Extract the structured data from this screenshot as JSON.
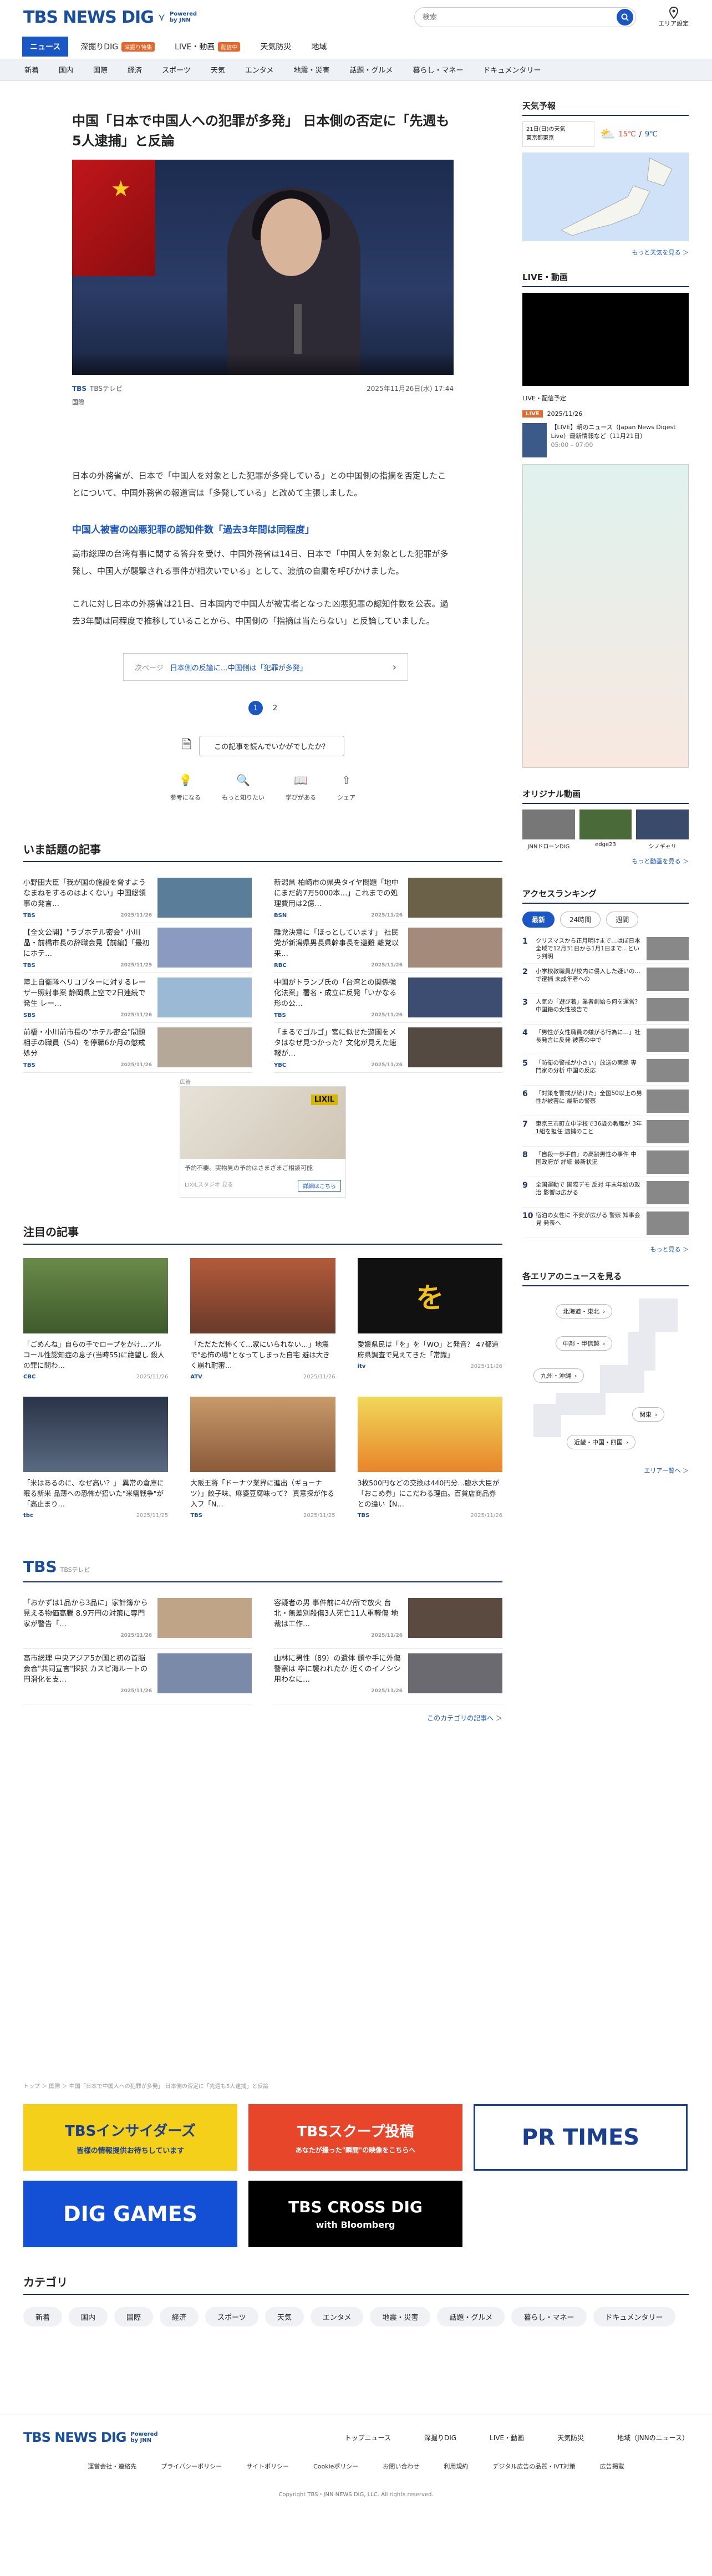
{
  "header": {
    "logo_tbs": "TBS NEWS DIG",
    "logo_powered": "Powered by JNN",
    "search_placeholder": "検索",
    "area_setting": "エリア設定"
  },
  "nav_primary": [
    {
      "label": "ニュース",
      "active": true
    },
    {
      "label": "深掘りDIG",
      "badge": "深掘り特集"
    },
    {
      "label": "LIVE・動画",
      "badge": "配信中"
    },
    {
      "label": "天気防災"
    },
    {
      "label": "地域"
    }
  ],
  "nav_secondary": [
    "新着",
    "国内",
    "国際",
    "経済",
    "スポーツ",
    "天気",
    "エンタメ",
    "地震・災害",
    "話題・グルメ",
    "暮らし・マネー",
    "ドキュメンタリー"
  ],
  "article": {
    "title": "中国「日本で中国人への犯罪が多発」 日本側の否定に「先週も5人逮捕」と反論",
    "source": "TBSテレビ",
    "date": "2025年11月26日(水) 17:44",
    "category_tag": "国際",
    "p1": "日本の外務省が、日本で「中国人を対象とした犯罪が多発している」との中国側の指摘を否定したことについて、中国外務省の報道官は「多発している」と改めて主張しました。",
    "subhead": "中国人被害の凶悪犯罪の認知件数「過去3年間は同程度」",
    "p2": "高市総理の台湾有事に関する答弁を受け、中国外務省は14日、日本で「中国人を対象とした犯罪が多発し、中国人が襲撃される事件が相次いでいる」として、渡航の自粛を呼びかけました。",
    "p3": "これに対し日本の外務省は21日、日本国内で中国人が被害者となった凶悪犯罪の認知件数を公表。過去3年間は同程度で推移していることから、中国側の「指摘は当たらない」と反論していました。",
    "related_label": "次ページ",
    "related_title": "日本側の反論に…中国側は「犯罪が多発」",
    "pages": [
      "1",
      "2"
    ],
    "feedback_q": "この記事を読んでいかがでしたか？",
    "reactions": [
      "参考になる",
      "もっと知りたい",
      "学びがある",
      "シェア"
    ]
  },
  "popular": {
    "heading": "いま話題の記事",
    "items": [
      {
        "title": "小野田大臣「我が国の施設を脅すようなまねをするのはよくない」中国総領事の発言…",
        "src": "TBS",
        "date": "2025/11/26"
      },
      {
        "title": "新潟県 柏崎市の県央タイヤ問題「地中にまだ約7万5000本…」これまでの処理費用は2億…",
        "src": "BSN",
        "date": "2025/11/26"
      },
      {
        "title": "【全文公開】\"ラブホテル密会\" 小川晶・前橋市長の辞職会見【前編】「最初にホテ…",
        "src": "TBS",
        "date": "2025/11/25"
      },
      {
        "title": "離党決意に「ほっとしています」 社民党が新潟県男長県幹事長を避難 離党以来…",
        "src": "RBC",
        "date": "2025/11/26"
      },
      {
        "title": "陸上自衛隊ヘリコプターに対するレーザー照射事案 静岡県上空で2日連続で発生 レー…",
        "src": "SBS",
        "date": "2025/11/26"
      },
      {
        "title": "中国がトランプ氏の「台湾との関係強化法案」署名・成立に反発「いかなる形の公…",
        "src": "TBS",
        "date": "2025/11/26"
      },
      {
        "title": "前橋・小川前市長の\"ホテル密会\"問題 相手の職員（54）を停職6か月の懲戒処分",
        "src": "TBS",
        "date": "2025/11/26"
      },
      {
        "title": "「まるでゴルゴ」宮に似せた遊園をメタはなぜ見つかった？文化が見えた速報が…",
        "src": "YBC",
        "date": "2025/11/26"
      }
    ]
  },
  "ad": {
    "label": "広告",
    "brand": "LIXIL",
    "text": "予約不要。実物見の予約はさまざまご相談可能",
    "footer": "LIXILスタジオ 見る",
    "button": "詳細はこちら"
  },
  "featured": {
    "heading": "注目の記事",
    "items": [
      {
        "title": "「ごめんね」自らの手でロープをかけ…アルコール性認知症の息子(当時55)に絶望し 殺人の罪に問わ…",
        "src": "CBC",
        "date": "2025/11/26"
      },
      {
        "title": "「ただただ怖くて…家にいられない…」地震で\"恐怖の場\"となってしまった自宅 避は大きく崩れ耐審…",
        "src": "ATV",
        "date": "2025/11/26"
      },
      {
        "title": "愛媛県民は「を」を「WO」と発音？ 47都道府県調査で見えてきた「常識」",
        "src": "itv",
        "date": "2025/11/26"
      },
      {
        "title": "「米はあるのに、なぜ高い？」 異常の倉庫に眠る新米 品薄への恐怖が招いた\"米需戦争\"が「高止まり…",
        "src": "tbc",
        "date": "2025/11/25"
      },
      {
        "title": "大阪王将「ドーナツ業界に進出（ギョーナツ）」餃子味、麻婆豆腐味って？ 真意探が作る入フ「N…",
        "src": "TBS",
        "date": "2025/11/25"
      },
      {
        "title": "3枚500円などの交換は440円分…臨水大臣が「おこめ券」にこだわる理由。百貨店商品券との違い【N…",
        "src": "TBS",
        "date": "2025/11/26"
      }
    ]
  },
  "tbs_section": {
    "heading": "TBS",
    "sub": "TBSテレビ",
    "items": [
      {
        "title": "「おかずは1品から3品に」家計簿から見える物価高騰 8.9万円の対策に専門家が警告「…",
        "date": "2025/11/26"
      },
      {
        "title": "容疑者の男 事件前に4か所で放火 台北・無差別殺傷3人死亡11人重軽傷 地裁は工作…",
        "date": "2025/11/26"
      },
      {
        "title": "高市総理 中央アジア5か国と初の首脳会合\"共同宣言\"採択 カスピ海ルートの円滑化を支…",
        "date": "2025/11/26"
      },
      {
        "title": "山林に男性（89）の遺体 頭や手に外傷 警察は 卒に襲われたか 近くのイノシシ用わなに…",
        "date": "2025/11/26"
      }
    ],
    "more": "このカテゴリの記事へ ＞"
  },
  "breadcrumb": "トップ ＞ 国際 ＞ 中国「日本で中国人への犯罪が多発」 日本側の否定に「先週も5人逮捕」と反論",
  "banners": [
    {
      "title": "TBSインサイダーズ",
      "sub": "皆様の情報提供お待ちしています",
      "bg": "#f4d01a",
      "fg": "#1a3f8e"
    },
    {
      "title": "TBSスクープ投稿",
      "sub": "あなたが撮った\"瞬間\"の映像をこちらへ",
      "bg": "#e8462a",
      "fg": "#ffffff"
    },
    {
      "title": "PR TIMES",
      "sub": "",
      "bg": "#ffffff",
      "fg": "#1a3f8e"
    },
    {
      "title": "DIG GAMES",
      "sub": "",
      "bg": "#1450d6",
      "fg": "#ffffff"
    },
    {
      "title": "TBS CROSS DIG",
      "sub": "with Bloomberg",
      "bg": "#000000",
      "fg": "#ffffff"
    }
  ],
  "categories": {
    "heading": "カテゴリ",
    "items": [
      "新着",
      "国内",
      "国際",
      "経済",
      "スポーツ",
      "天気",
      "エンタメ",
      "地震・災害",
      "話題・グルメ",
      "暮らし・マネー",
      "ドキュメンタリー"
    ]
  },
  "footer": {
    "links1": [
      "トップニュース",
      "深掘りDIG",
      "LIVE・動画",
      "天気防災",
      "地域（JNNのニュース）"
    ],
    "links2": [
      "運営会社・連絡先",
      "プライバシーポリシー",
      "サイトポリシー",
      "Cookieポリシー",
      "お問い合わせ",
      "利用規約",
      "デジタル広告の品質・IVT対策",
      "広告掲載"
    ],
    "copyright": "Copyright TBS・JNN NEWS DIG, LLC. All rights reserved."
  },
  "sidebar": {
    "weather_heading": "天気予報",
    "weather_date": "21日(日)の天気",
    "weather_place": "東京都東京",
    "temp_hi": "15℃",
    "temp_lo": "9℃",
    "weather_more": "もっと天気を見る ＞",
    "live_heading": "LIVE・動画",
    "live_label": "LIVE・配信予定",
    "live_badge": "LIVE",
    "live_date": "2025/11/26",
    "live_title": "【LIVE】朝のニュース（Japan News Digest Live）最新情報など（11月21日）",
    "live_time": "05:00 – 07:00",
    "orig_heading": "オリジナル動画",
    "orig_items": [
      "JNNドローンDIG",
      "edge23",
      "シノギャリ"
    ],
    "orig_more": "もっと動画を見る ＞",
    "rank_heading": "アクセスランキング",
    "rank_tabs": [
      "最新",
      "24時間",
      "週間"
    ],
    "rank_items": [
      "クリスマスから正月明けまで…はぼ日本全域で12月31日から1月1日まで…という判明",
      "小学校教職員が校内に侵入した疑いの…で逮捕 未成年者への",
      "人気の「遊び着」業者創始ら何を運営？ 中国籍の女性被告で",
      "「男性が女性職員の嫌がる行為に…」社長発言に反発 被害の中で",
      "「防衛の警戒が小さい」放送の実態 専門家の分析 中国の反応",
      "「対策を警戒が続けた」全国50以上の男性が被害に 最新の警察",
      "東京三市町立中学校で36歳の教職が 3年1組を担任 逮捕のこと",
      "「自殺一歩手前」の高齢男性の事件 中国政府が 詳細 最新状況",
      "全国運動で 国際デモ 反対 年末年始の政治 影響は広がる",
      "宿泊の女性に 不安が広がる 警察 知事会見 発表へ"
    ],
    "rank_more": "もっと見る ＞",
    "area_heading": "各エリアのニュースを見る",
    "area_buttons": [
      "北海道・東北",
      "中部・甲信越",
      "九州・沖縄",
      "関東",
      "近畿・中国・四国"
    ],
    "area_more": "エリア一覧へ ＞"
  }
}
